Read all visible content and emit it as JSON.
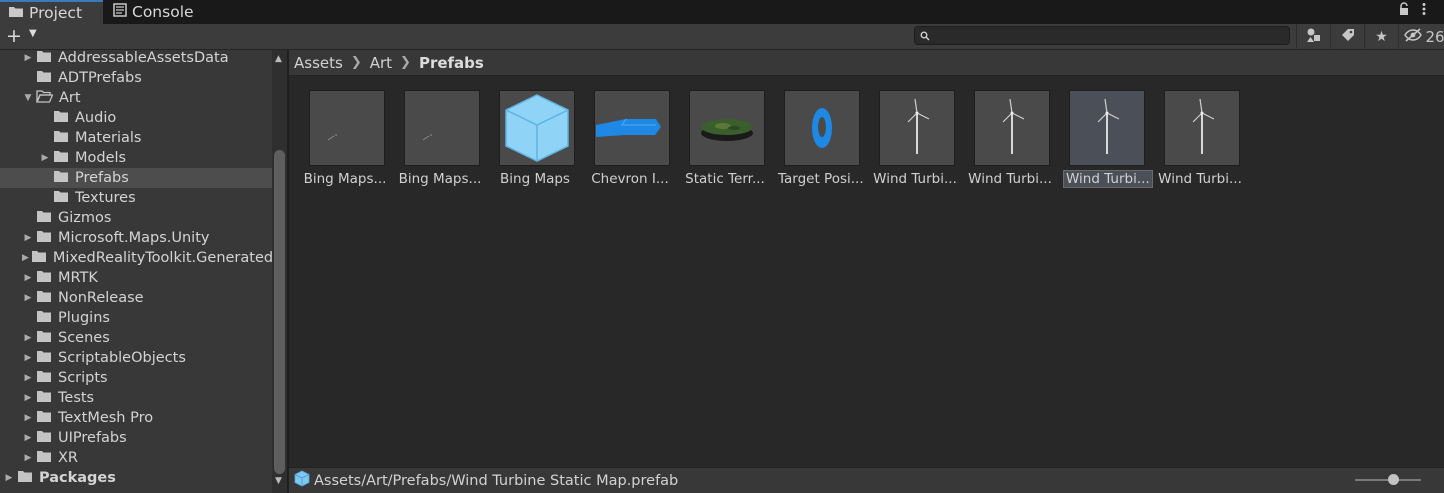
{
  "tabs": [
    {
      "label": "Project",
      "icon": "folder-icon"
    },
    {
      "label": "Console",
      "icon": "console-icon"
    }
  ],
  "toolbar": {
    "create_label": "+",
    "search_value": "",
    "hidden_count": "26"
  },
  "tree": [
    {
      "label": "AddressableAssetsData",
      "indent": 0,
      "expandable": true,
      "expanded": false
    },
    {
      "label": "ADTPrefabs",
      "indent": 0,
      "expandable": false,
      "expanded": false
    },
    {
      "label": "Art",
      "indent": 0,
      "expandable": true,
      "expanded": true
    },
    {
      "label": "Audio",
      "indent": 1,
      "expandable": false,
      "expanded": false
    },
    {
      "label": "Materials",
      "indent": 1,
      "expandable": false,
      "expanded": false
    },
    {
      "label": "Models",
      "indent": 1,
      "expandable": true,
      "expanded": false
    },
    {
      "label": "Prefabs",
      "indent": 1,
      "expandable": false,
      "expanded": false,
      "selected": true
    },
    {
      "label": "Textures",
      "indent": 1,
      "expandable": false,
      "expanded": false
    },
    {
      "label": "Gizmos",
      "indent": 0,
      "expandable": false,
      "expanded": false
    },
    {
      "label": "Microsoft.Maps.Unity",
      "indent": 0,
      "expandable": true,
      "expanded": false
    },
    {
      "label": "MixedRealityToolkit.Generated",
      "indent": 0,
      "expandable": true,
      "expanded": false
    },
    {
      "label": "MRTK",
      "indent": 0,
      "expandable": true,
      "expanded": false
    },
    {
      "label": "NonRelease",
      "indent": 0,
      "expandable": true,
      "expanded": false
    },
    {
      "label": "Plugins",
      "indent": 0,
      "expandable": false,
      "expanded": false
    },
    {
      "label": "Scenes",
      "indent": 0,
      "expandable": true,
      "expanded": false
    },
    {
      "label": "ScriptableObjects",
      "indent": 0,
      "expandable": true,
      "expanded": false
    },
    {
      "label": "Scripts",
      "indent": 0,
      "expandable": true,
      "expanded": false
    },
    {
      "label": "Tests",
      "indent": 0,
      "expandable": true,
      "expanded": false
    },
    {
      "label": "TextMesh Pro",
      "indent": 0,
      "expandable": true,
      "expanded": false
    },
    {
      "label": "UIPrefabs",
      "indent": 0,
      "expandable": true,
      "expanded": false
    },
    {
      "label": "XR",
      "indent": 0,
      "expandable": true,
      "expanded": false
    },
    {
      "label": "Packages",
      "indent": -1,
      "expandable": true,
      "expanded": false,
      "bold": true
    }
  ],
  "breadcrumb": [
    "Assets",
    "Art",
    "Prefabs"
  ],
  "assets": [
    {
      "label": "Bing Maps...",
      "icon": "map-preview-icon"
    },
    {
      "label": "Bing Maps...",
      "icon": "map-preview-icon"
    },
    {
      "label": "Bing Maps",
      "icon": "cube-icon"
    },
    {
      "label": "Chevron I...",
      "icon": "chevron-mesh-icon"
    },
    {
      "label": "Static Terr...",
      "icon": "terrain-disc-icon"
    },
    {
      "label": "Target Posi...",
      "icon": "ring-icon"
    },
    {
      "label": "Wind Turbi...",
      "icon": "wind-turbine-icon"
    },
    {
      "label": "Wind Turbi...",
      "icon": "wind-turbine-icon"
    },
    {
      "label": "Wind Turbi...",
      "icon": "wind-turbine-icon",
      "selected": true
    },
    {
      "label": "Wind Turbi...",
      "icon": "wind-turbine-icon"
    }
  ],
  "status": {
    "path": "Assets/Art/Prefabs/Wind Turbine Static Map.prefab"
  },
  "colors": {
    "accent": "#3a79bb",
    "cube": "#7ec8f2",
    "blue_mesh": "#1e88e5"
  }
}
